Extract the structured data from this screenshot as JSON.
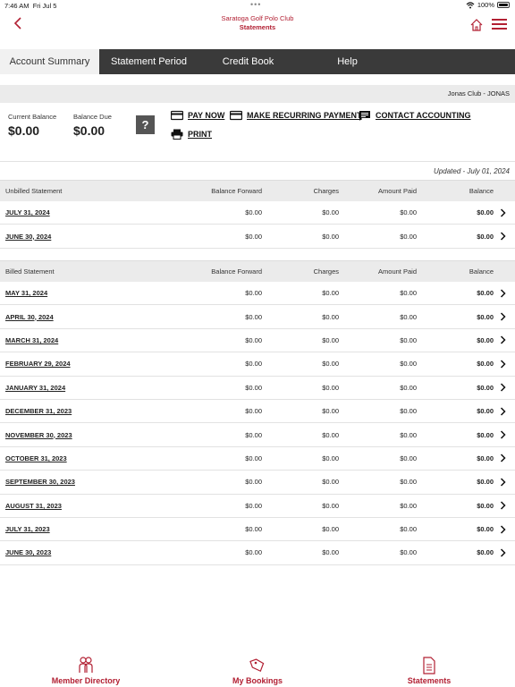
{
  "status_bar": {
    "time": "7:46 AM",
    "date": "Fri Jul 5",
    "battery": "100%"
  },
  "header": {
    "club_name": "Saratoga Golf Polo Club",
    "subtitle": "Statements"
  },
  "tabs": [
    {
      "label": "Account Summary",
      "active": true
    },
    {
      "label": "Statement Period",
      "active": false
    },
    {
      "label": "Credit Book",
      "active": false
    },
    {
      "label": "Help",
      "active": false
    }
  ],
  "club_row": "Jonas Club - JONAS",
  "balances": {
    "current_label": "Current Balance",
    "current_value": "$0.00",
    "due_label": "Balance Due",
    "due_value": "$0.00",
    "help_label": "?"
  },
  "actions": {
    "pay_now": "PAY NOW",
    "recurring": "MAKE RECURRING PAYMENT",
    "contact": "CONTACT ACCOUNTING",
    "print": "PRINT"
  },
  "updated": "Updated - July 01, 2024",
  "unbilled": {
    "headers": {
      "name": "Unbilled Statement",
      "bf": "Balance Forward",
      "ch": "Charges",
      "ap": "Amount Paid",
      "bal": "Balance"
    },
    "rows": [
      {
        "name": "JULY 31, 2024",
        "bf": "$0.00",
        "ch": "$0.00",
        "ap": "$0.00",
        "bal": "$0.00"
      },
      {
        "name": "JUNE 30, 2024",
        "bf": "$0.00",
        "ch": "$0.00",
        "ap": "$0.00",
        "bal": "$0.00"
      }
    ]
  },
  "billed": {
    "headers": {
      "name": "Billed Statement",
      "bf": "Balance Forward",
      "ch": "Charges",
      "ap": "Amount Paid",
      "bal": "Balance"
    },
    "rows": [
      {
        "name": "MAY 31, 2024",
        "bf": "$0.00",
        "ch": "$0.00",
        "ap": "$0.00",
        "bal": "$0.00"
      },
      {
        "name": "APRIL 30, 2024",
        "bf": "$0.00",
        "ch": "$0.00",
        "ap": "$0.00",
        "bal": "$0.00"
      },
      {
        "name": "MARCH 31, 2024",
        "bf": "$0.00",
        "ch": "$0.00",
        "ap": "$0.00",
        "bal": "$0.00"
      },
      {
        "name": "FEBRUARY 29, 2024",
        "bf": "$0.00",
        "ch": "$0.00",
        "ap": "$0.00",
        "bal": "$0.00"
      },
      {
        "name": "JANUARY 31, 2024",
        "bf": "$0.00",
        "ch": "$0.00",
        "ap": "$0.00",
        "bal": "$0.00"
      },
      {
        "name": "DECEMBER 31, 2023",
        "bf": "$0.00",
        "ch": "$0.00",
        "ap": "$0.00",
        "bal": "$0.00"
      },
      {
        "name": "NOVEMBER 30, 2023",
        "bf": "$0.00",
        "ch": "$0.00",
        "ap": "$0.00",
        "bal": "$0.00"
      },
      {
        "name": "OCTOBER 31, 2023",
        "bf": "$0.00",
        "ch": "$0.00",
        "ap": "$0.00",
        "bal": "$0.00"
      },
      {
        "name": "SEPTEMBER 30, 2023",
        "bf": "$0.00",
        "ch": "$0.00",
        "ap": "$0.00",
        "bal": "$0.00"
      },
      {
        "name": "AUGUST 31, 2023",
        "bf": "$0.00",
        "ch": "$0.00",
        "ap": "$0.00",
        "bal": "$0.00"
      },
      {
        "name": "JULY 31, 2023",
        "bf": "$0.00",
        "ch": "$0.00",
        "ap": "$0.00",
        "bal": "$0.00"
      },
      {
        "name": "JUNE 30, 2023",
        "bf": "$0.00",
        "ch": "$0.00",
        "ap": "$0.00",
        "bal": "$0.00"
      }
    ]
  },
  "bottom_nav": [
    {
      "label": "Member Directory",
      "icon": "people-icon"
    },
    {
      "label": "My Bookings",
      "icon": "tag-icon"
    },
    {
      "label": "Statements",
      "icon": "document-icon"
    }
  ],
  "colors": {
    "accent": "#b22033",
    "tab_bar": "#3a3a3a"
  }
}
